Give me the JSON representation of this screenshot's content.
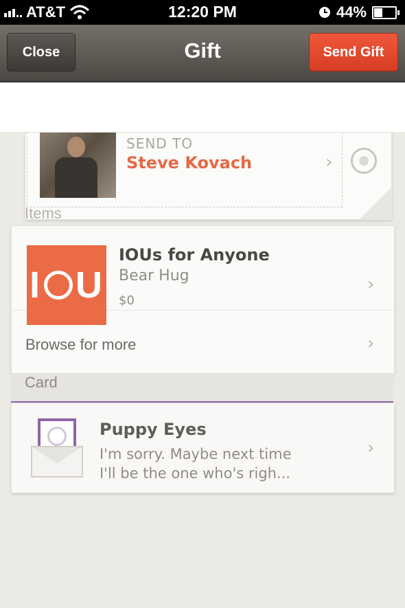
{
  "status_bar": {
    "carrier": "AT&T",
    "time": "12:20 PM",
    "battery_percent": "44%",
    "battery_level": 0.44,
    "icons": [
      "signal-icon",
      "wifi-icon",
      "clock-icon",
      "battery-icon"
    ]
  },
  "nav": {
    "close_label": "Close",
    "title": "Gift",
    "send_label": "Send Gift"
  },
  "send_to": {
    "label": "SEND TO",
    "recipient": "Steve Kovach"
  },
  "items": {
    "header": "Items",
    "item": {
      "name": "IOUs for Anyone",
      "variant": "Bear Hug",
      "price": "$0",
      "icon_text": "IOU"
    },
    "browse_label": "Browse for more"
  },
  "card": {
    "header": "Card",
    "title": "Puppy Eyes",
    "message_line1": "I'm sorry. Maybe next time",
    "message_line2": "I'll be the one who's righ..."
  },
  "colors": {
    "accent": "#e56a45",
    "send_button": "#e8492d",
    "card_divider": "#8e63a8",
    "nav_bg": "#5c5954"
  }
}
